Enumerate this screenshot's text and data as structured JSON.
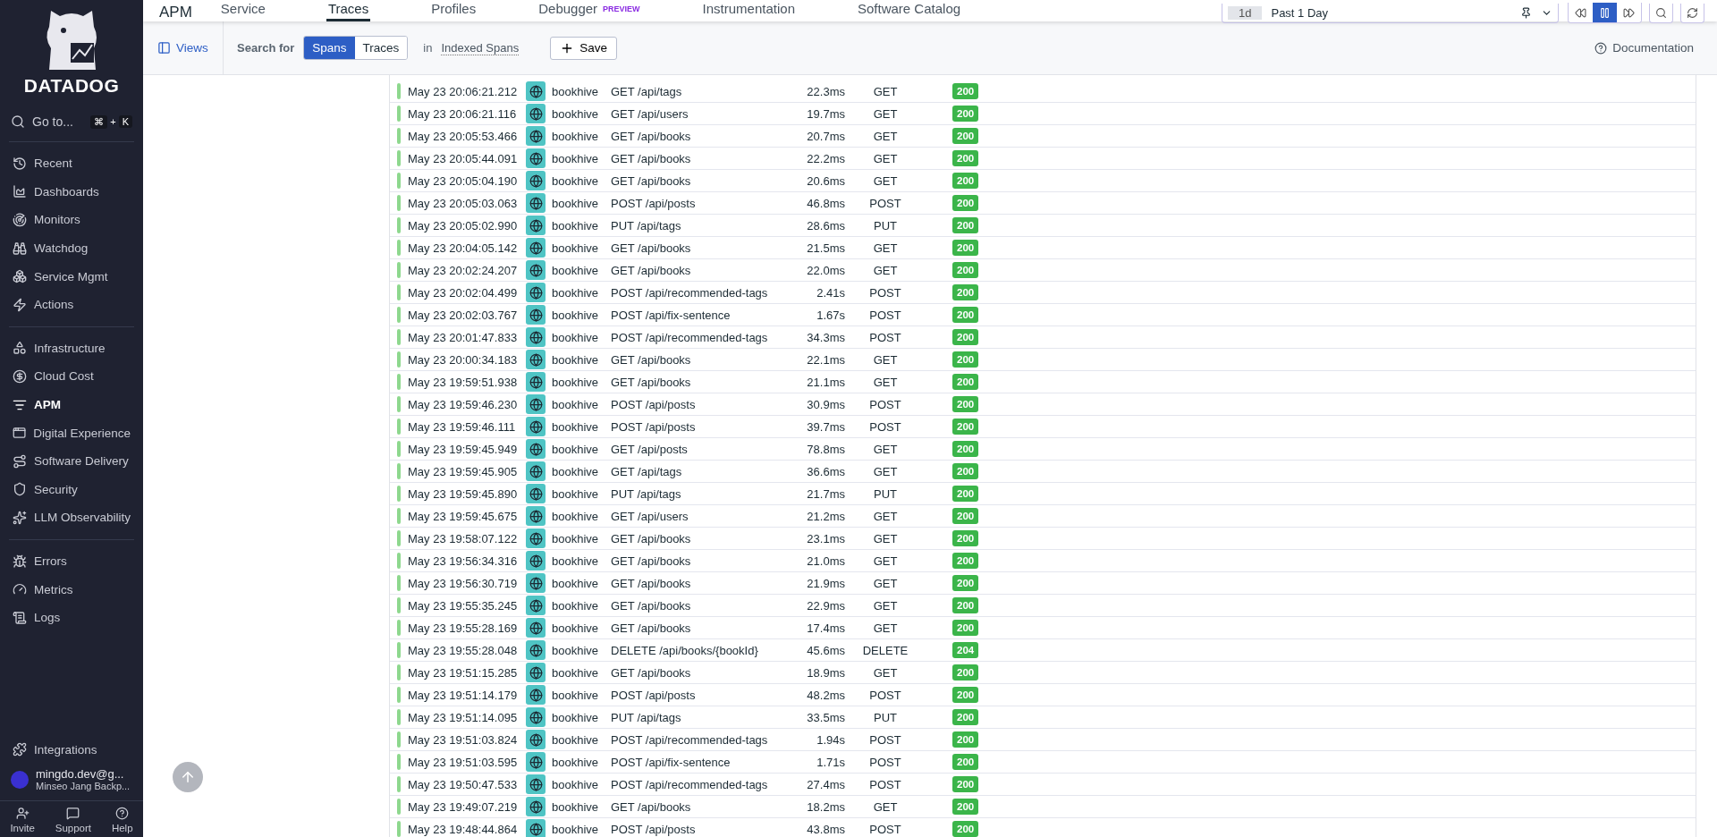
{
  "sidebar": {
    "logo": "DATADOG",
    "goto": {
      "label": "Go to...",
      "keys": [
        "⌘",
        "+",
        "K"
      ]
    },
    "groups": [
      [
        {
          "label": "Recent",
          "selected": false
        },
        {
          "label": "Dashboards",
          "selected": false
        },
        {
          "label": "Monitors",
          "selected": false
        },
        {
          "label": "Watchdog",
          "selected": false
        },
        {
          "label": "Service Mgmt",
          "selected": false
        },
        {
          "label": "Actions",
          "selected": false
        }
      ],
      [
        {
          "label": "Infrastructure",
          "selected": false
        },
        {
          "label": "Cloud Cost",
          "selected": false
        },
        {
          "label": "APM",
          "selected": true
        },
        {
          "label": "Digital Experience",
          "selected": false
        },
        {
          "label": "Software Delivery",
          "selected": false
        },
        {
          "label": "Security",
          "selected": false
        },
        {
          "label": "LLM Observability",
          "selected": false
        }
      ],
      [
        {
          "label": "Errors",
          "selected": false
        },
        {
          "label": "Metrics",
          "selected": false
        },
        {
          "label": "Logs",
          "selected": false
        }
      ]
    ],
    "integrations": "Integrations",
    "user": {
      "email": "mingdo.dev@g...",
      "org": "Minseo Jang Backp..."
    },
    "footer": [
      "Invite",
      "Support",
      "Help"
    ]
  },
  "topbar": {
    "title": "APM",
    "tabs": [
      {
        "label": "Service",
        "selected": false
      },
      {
        "label": "Traces",
        "selected": true
      },
      {
        "label": "Profiles",
        "selected": false
      },
      {
        "label": "Debugger",
        "selected": false,
        "badge": "PREVIEW"
      },
      {
        "label": "Instrumentation",
        "selected": false
      },
      {
        "label": "Software Catalog",
        "selected": false
      }
    ],
    "time": {
      "short": "1d",
      "label": "Past 1 Day"
    },
    "time_controls": [
      {
        "kind": "rewind",
        "selected": false
      },
      {
        "kind": "pause",
        "selected": true
      },
      {
        "kind": "forward",
        "selected": false
      }
    ]
  },
  "searchbar": {
    "views": "Views",
    "search_for": "Search for",
    "modes": [
      {
        "label": "Spans",
        "selected": true
      },
      {
        "label": "Traces",
        "selected": false
      }
    ],
    "in": "in",
    "index": "Indexed Spans",
    "save": "Save",
    "documentation": "Documentation"
  },
  "table": {
    "rows": [
      [
        "May 23 20:06:21.212",
        "bookhive",
        "GET /api/tags",
        "22.3ms",
        "GET",
        "200"
      ],
      [
        "May 23 20:06:21.116",
        "bookhive",
        "GET /api/users",
        "19.7ms",
        "GET",
        "200"
      ],
      [
        "May 23 20:05:53.466",
        "bookhive",
        "GET /api/books",
        "20.7ms",
        "GET",
        "200"
      ],
      [
        "May 23 20:05:44.091",
        "bookhive",
        "GET /api/books",
        "22.2ms",
        "GET",
        "200"
      ],
      [
        "May 23 20:05:04.190",
        "bookhive",
        "GET /api/books",
        "20.6ms",
        "GET",
        "200"
      ],
      [
        "May 23 20:05:03.063",
        "bookhive",
        "POST /api/posts",
        "46.8ms",
        "POST",
        "200"
      ],
      [
        "May 23 20:05:02.990",
        "bookhive",
        "PUT /api/tags",
        "28.6ms",
        "PUT",
        "200"
      ],
      [
        "May 23 20:04:05.142",
        "bookhive",
        "GET /api/books",
        "21.5ms",
        "GET",
        "200"
      ],
      [
        "May 23 20:02:24.207",
        "bookhive",
        "GET /api/books",
        "22.0ms",
        "GET",
        "200"
      ],
      [
        "May 23 20:02:04.499",
        "bookhive",
        "POST /api/recommended-tags",
        "2.41s",
        "POST",
        "200"
      ],
      [
        "May 23 20:02:03.767",
        "bookhive",
        "POST /api/fix-sentence",
        "1.67s",
        "POST",
        "200"
      ],
      [
        "May 23 20:01:47.833",
        "bookhive",
        "POST /api/recommended-tags",
        "34.3ms",
        "POST",
        "200"
      ],
      [
        "May 23 20:00:34.183",
        "bookhive",
        "GET /api/books",
        "22.1ms",
        "GET",
        "200"
      ],
      [
        "May 23 19:59:51.938",
        "bookhive",
        "GET /api/books",
        "21.1ms",
        "GET",
        "200"
      ],
      [
        "May 23 19:59:46.230",
        "bookhive",
        "POST /api/posts",
        "30.9ms",
        "POST",
        "200"
      ],
      [
        "May 23 19:59:46.111",
        "bookhive",
        "POST /api/posts",
        "39.7ms",
        "POST",
        "200"
      ],
      [
        "May 23 19:59:45.949",
        "bookhive",
        "GET /api/posts",
        "78.8ms",
        "GET",
        "200"
      ],
      [
        "May 23 19:59:45.905",
        "bookhive",
        "GET /api/tags",
        "36.6ms",
        "GET",
        "200"
      ],
      [
        "May 23 19:59:45.890",
        "bookhive",
        "PUT /api/tags",
        "21.7ms",
        "PUT",
        "200"
      ],
      [
        "May 23 19:59:45.675",
        "bookhive",
        "GET /api/users",
        "21.2ms",
        "GET",
        "200"
      ],
      [
        "May 23 19:58:07.122",
        "bookhive",
        "GET /api/books",
        "23.1ms",
        "GET",
        "200"
      ],
      [
        "May 23 19:56:34.316",
        "bookhive",
        "GET /api/books",
        "21.0ms",
        "GET",
        "200"
      ],
      [
        "May 23 19:56:30.719",
        "bookhive",
        "GET /api/books",
        "21.9ms",
        "GET",
        "200"
      ],
      [
        "May 23 19:55:35.245",
        "bookhive",
        "GET /api/books",
        "22.9ms",
        "GET",
        "200"
      ],
      [
        "May 23 19:55:28.169",
        "bookhive",
        "GET /api/books",
        "17.4ms",
        "GET",
        "200"
      ],
      [
        "May 23 19:55:28.048",
        "bookhive",
        "DELETE /api/books/{bookId}",
        "45.6ms",
        "DELETE",
        "204"
      ],
      [
        "May 23 19:51:15.285",
        "bookhive",
        "GET /api/books",
        "18.9ms",
        "GET",
        "200"
      ],
      [
        "May 23 19:51:14.179",
        "bookhive",
        "POST /api/posts",
        "48.2ms",
        "POST",
        "200"
      ],
      [
        "May 23 19:51:14.095",
        "bookhive",
        "PUT /api/tags",
        "33.5ms",
        "PUT",
        "200"
      ],
      [
        "May 23 19:51:03.824",
        "bookhive",
        "POST /api/recommended-tags",
        "1.94s",
        "POST",
        "200"
      ],
      [
        "May 23 19:51:03.595",
        "bookhive",
        "POST /api/fix-sentence",
        "1.71s",
        "POST",
        "200"
      ],
      [
        "May 23 19:50:47.533",
        "bookhive",
        "POST /api/recommended-tags",
        "27.4ms",
        "POST",
        "200"
      ],
      [
        "May 23 19:49:07.219",
        "bookhive",
        "GET /api/books",
        "18.2ms",
        "GET",
        "200"
      ],
      [
        "May 23 19:48:44.864",
        "bookhive",
        "POST /api/posts",
        "43.8ms",
        "POST",
        "200"
      ]
    ]
  }
}
